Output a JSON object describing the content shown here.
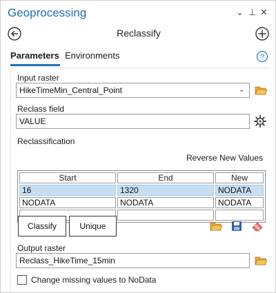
{
  "pane": {
    "title": "Geoprocessing",
    "controls": {
      "menu": "⌄",
      "pin": "⊥",
      "close": "✕"
    }
  },
  "tool": {
    "title": "Reclassify"
  },
  "tabs": [
    {
      "label": "Parameters",
      "active": true
    },
    {
      "label": "Environments",
      "active": false
    }
  ],
  "params": {
    "input_raster": {
      "label": "Input raster",
      "value": "HikeTimeMin_Central_Point"
    },
    "reclass_field": {
      "label": "Reclass field",
      "value": "VALUE"
    },
    "reclassification": {
      "label": "Reclassification",
      "reverse_label": "Reverse New Values",
      "columns": [
        "Start",
        "End",
        "New"
      ],
      "rows": [
        [
          "16",
          "1320",
          "NODATA"
        ],
        [
          "NODATA",
          "NODATA",
          "NODATA"
        ],
        [
          "",
          "",
          ""
        ]
      ],
      "buttons": {
        "classify": "Classify",
        "unique": "Unique"
      }
    },
    "output_raster": {
      "label": "Output raster",
      "value": "Reclass_HikeTime_15min"
    },
    "missing_checkbox": {
      "label": "Change missing values to NoData",
      "checked": false
    }
  },
  "colors": {
    "accent": "#1f6fb5",
    "folder": "#e8a93a",
    "save": "#2f5fa8",
    "eraser": "#e07a7a",
    "selected_row": "#c6dff3"
  }
}
